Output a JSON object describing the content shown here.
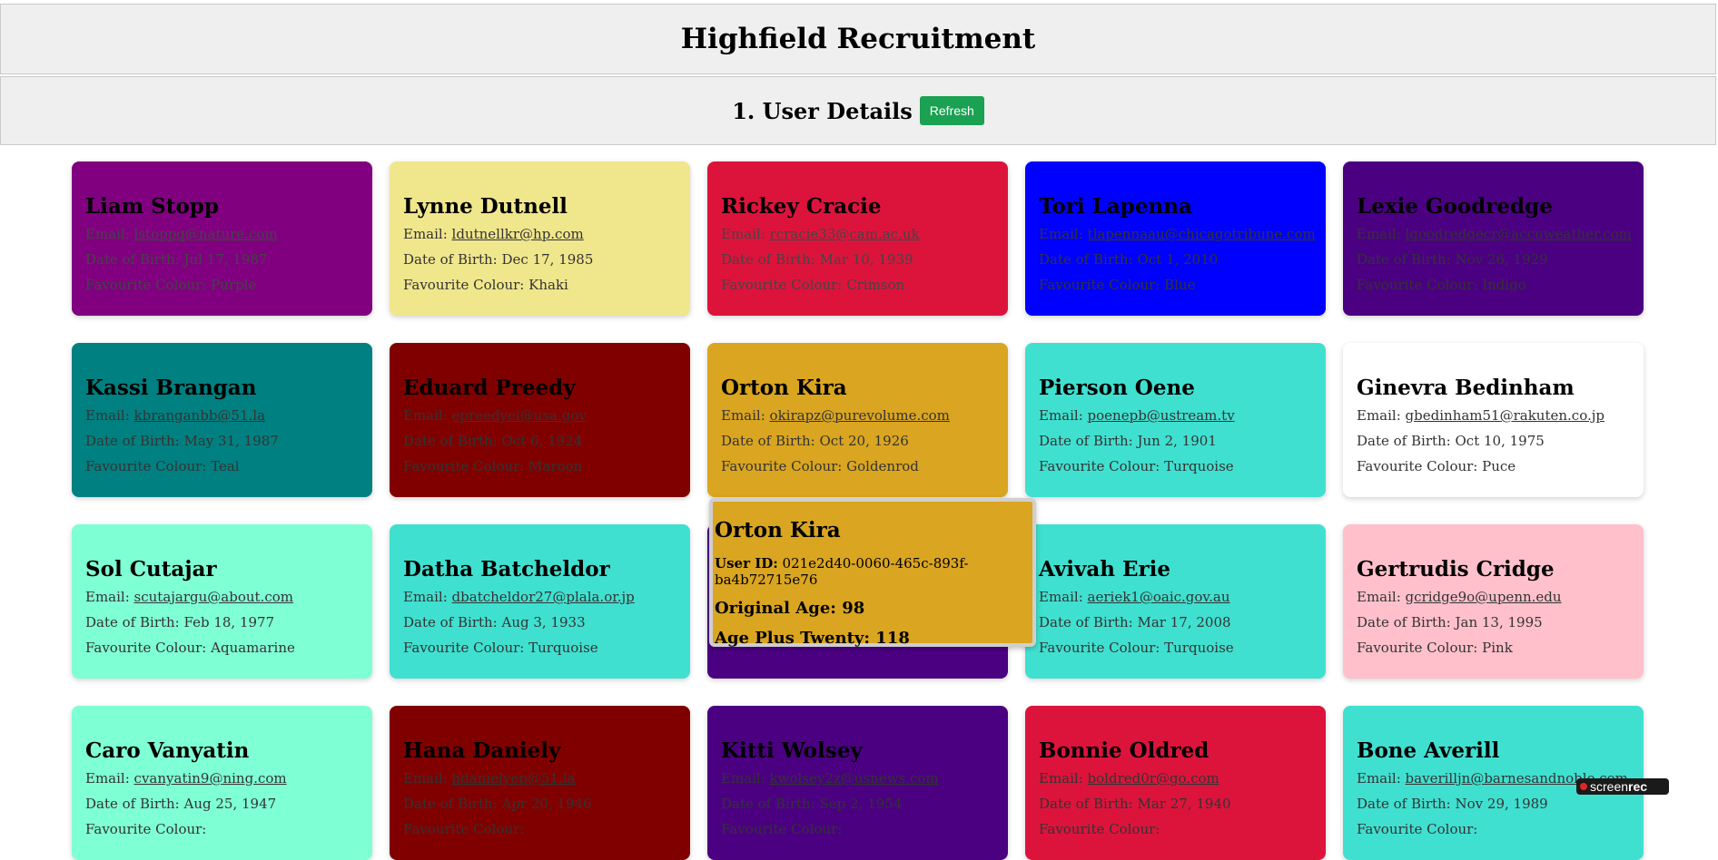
{
  "header": {
    "title": "Highfield Recruitment"
  },
  "section": {
    "title": "1. User Details",
    "refresh_label": "Refresh",
    "refresh_color": "#1aa152"
  },
  "labels": {
    "email": "Email: ",
    "dob": "Date of Birth: ",
    "colour": "Favourite Colour: "
  },
  "users": [
    {
      "name": "Liam Stopp",
      "email": "lstoppq@nature.com",
      "dob": "Jul 17, 1987",
      "colour": "Purple",
      "bg": "#800080",
      "fg": "#000000",
      "sub": "#444444"
    },
    {
      "name": "Lynne Dutnell",
      "email": "ldutnellkr@hp.com",
      "dob": "Dec 17, 1985",
      "colour": "Khaki",
      "bg": "#f0e68c",
      "fg": "#000000",
      "sub": "#333333"
    },
    {
      "name": "Rickey Cracie",
      "email": "rcracie33@cam.ac.uk",
      "dob": "Mar 10, 1939",
      "colour": "Crimson",
      "bg": "#dc143c",
      "fg": "#000000",
      "sub": "#444444"
    },
    {
      "name": "Tori Lapenna",
      "email": "tlapennaau@chicagotribune.com",
      "dob": "Oct 1, 2010",
      "colour": "Blue",
      "bg": "#0000ff",
      "fg": "#000000",
      "sub": "#333333"
    },
    {
      "name": "Lexie Goodredge",
      "email": "lgoodredgecr@accuweather.com",
      "dob": "Nov 26, 1929",
      "colour": "Indigo",
      "bg": "#4b0082",
      "fg": "#000000",
      "sub": "#333333"
    },
    {
      "name": "Kassi Brangan",
      "email": "kbranganbb@51.la",
      "dob": "May 31, 1987",
      "colour": "Teal",
      "bg": "#008080",
      "fg": "#000000",
      "sub": "#333333"
    },
    {
      "name": "Eduard Preedy",
      "email": "epreedyei@usa.gov",
      "dob": "Oct 6, 1924",
      "colour": "Maroon",
      "bg": "#800000",
      "fg": "#000000",
      "sub": "#333333"
    },
    {
      "name": "Orton Kira",
      "email": "okirapz@purevolume.com",
      "dob": "Oct 20, 1926",
      "colour": "Goldenrod",
      "bg": "#daa520",
      "fg": "#000000",
      "sub": "#333333"
    },
    {
      "name": "Pierson Oene",
      "email": "poenepb@ustream.tv",
      "dob": "Jun 2, 1901",
      "colour": "Turquoise",
      "bg": "#40e0d0",
      "fg": "#000000",
      "sub": "#333333"
    },
    {
      "name": "Ginevra Bedinham",
      "email": "gbedinham51@rakuten.co.jp",
      "dob": "Oct 10, 1975",
      "colour": "Puce",
      "bg": "#ffffff",
      "fg": "#000000",
      "sub": "#333333"
    },
    {
      "name": "Sol Cutajar",
      "email": "scutajargu@about.com",
      "dob": "Feb 18, 1977",
      "colour": "Aquamarine",
      "bg": "#7fffd4",
      "fg": "#000000",
      "sub": "#333333"
    },
    {
      "name": "Datha Batcheldor",
      "email": "dbatcheldor27@plala.or.jp",
      "dob": "Aug 3, 1933",
      "colour": "Turquoise",
      "bg": "#40e0d0",
      "fg": "#000000",
      "sub": "#333333"
    },
    {
      "name": "",
      "email": "",
      "dob": "",
      "colour": "Indigo",
      "bg": "#4b0082",
      "fg": "#000000",
      "sub": "#333333"
    },
    {
      "name": "Avivah Erie",
      "email": "aeriek1@oaic.gov.au",
      "dob": "Mar 17, 2008",
      "colour": "Turquoise",
      "bg": "#40e0d0",
      "fg": "#000000",
      "sub": "#333333"
    },
    {
      "name": "Gertrudis Cridge",
      "email": "gcridge9o@upenn.edu",
      "dob": "Jan 13, 1995",
      "colour": "Pink",
      "bg": "#ffc0cb",
      "fg": "#000000",
      "sub": "#333333"
    },
    {
      "name": "Caro Vanyatin",
      "email": "cvanyatin9@ning.com",
      "dob": "Aug 25, 1947",
      "colour": "",
      "bg": "#7fffd4",
      "fg": "#000000",
      "sub": "#333333"
    },
    {
      "name": "Hana Daniely",
      "email": "hdanielyep@51.la",
      "dob": "Apr 20, 1946",
      "colour": "",
      "bg": "#800000",
      "fg": "#000000",
      "sub": "#333333"
    },
    {
      "name": "Kitti Wolsey",
      "email": "kwolsey2z@usnews.com",
      "dob": "Sep 2, 1954",
      "colour": "",
      "bg": "#4b0082",
      "fg": "#000000",
      "sub": "#333333"
    },
    {
      "name": "Bonnie Oldred",
      "email": "boldred0r@go.com",
      "dob": "Mar 27, 1940",
      "colour": "",
      "bg": "#dc143c",
      "fg": "#000000",
      "sub": "#333333"
    },
    {
      "name": "Bone Averill",
      "email": "baverilljn@barnesandnoble.com",
      "dob": "Nov 29, 1989",
      "colour": "",
      "bg": "#40e0d0",
      "fg": "#000000",
      "sub": "#333333"
    }
  ],
  "popup": {
    "name": "Orton Kira",
    "user_id_label": "User ID:",
    "user_id": "021e2d40-0060-465c-893f-ba4b72715e76",
    "orig_age_label": "Original Age:",
    "orig_age": "98",
    "plus_label": "Age Plus Twenty:",
    "plus_age": "118"
  },
  "watermark": {
    "text_light": "screen",
    "text_bold": "rec"
  }
}
